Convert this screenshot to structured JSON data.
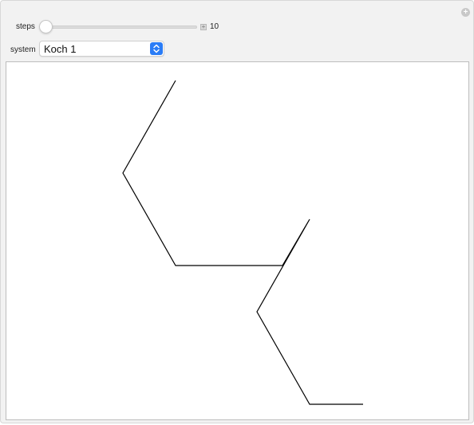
{
  "controls": {
    "steps": {
      "label": "steps",
      "value": "10",
      "min": 0,
      "max": 10,
      "position": 0
    },
    "system": {
      "label": "system",
      "selected": "Koch 1"
    }
  },
  "icons": {
    "panel_plus": "plus-circle-icon",
    "slider_plus": "plus-square-icon",
    "select_arrows": "chevron-up-down-icon"
  },
  "colors": {
    "accent": "#2a7cf6",
    "panel": "#f2f2f2",
    "curve": "#000000"
  },
  "curve": {
    "points": [
      [
        212,
        23
      ],
      [
        146,
        139
      ],
      [
        212,
        255
      ],
      [
        346,
        255
      ],
      [
        380,
        197
      ],
      [
        314,
        313
      ],
      [
        380,
        429
      ],
      [
        447,
        429
      ]
    ]
  }
}
